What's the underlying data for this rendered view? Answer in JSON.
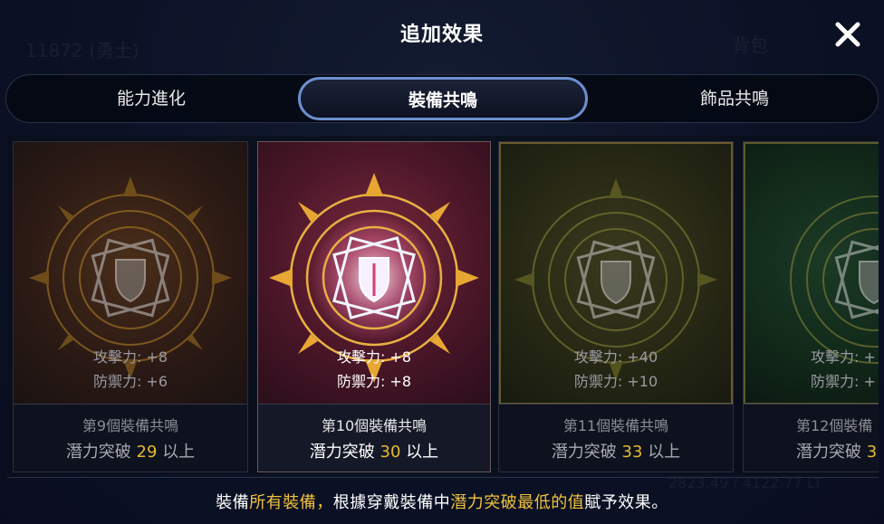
{
  "background": {
    "ghost_1": "11872 (勇士)",
    "ghost_2": "背包",
    "ghost_3": "2823.49 / 4122.77 LT"
  },
  "dialog": {
    "title": "追加效果"
  },
  "tabs": [
    {
      "label": "能力進化",
      "active": false
    },
    {
      "label": "裝備共鳴",
      "active": true
    },
    {
      "label": "飾品共鳴",
      "active": false
    }
  ],
  "cards": [
    {
      "atk": "攻擊力: +8",
      "def": "防禦力: +6",
      "name": "第9個裝備共鳴",
      "cond_prefix": "潛力突破",
      "cond_num": "29",
      "cond_suffix": "以上"
    },
    {
      "atk": "攻擊力: +8",
      "def": "防禦力: +8",
      "name": "第10個裝備共鳴",
      "cond_prefix": "潛力突破",
      "cond_num": "30",
      "cond_suffix": "以上"
    },
    {
      "atk": "攻擊力: +40",
      "def": "防禦力: +10",
      "name": "第11個裝備共鳴",
      "cond_prefix": "潛力突破",
      "cond_num": "33",
      "cond_suffix": "以上"
    },
    {
      "atk": "攻擊力: +",
      "def": "防禦力: +",
      "name": "第12個裝備",
      "cond_prefix": "潛力突破",
      "cond_num": "3",
      "cond_suffix": ""
    }
  ],
  "note": {
    "part1": "裝備",
    "hl1": "所有裝備，",
    "part2": "根據穿戴裝備中",
    "hl2": "潛力突破最低的值",
    "part3": "賦予效果。"
  },
  "colors": {
    "accent": "#f0c23a",
    "tab_border": "#6d8fd0"
  }
}
